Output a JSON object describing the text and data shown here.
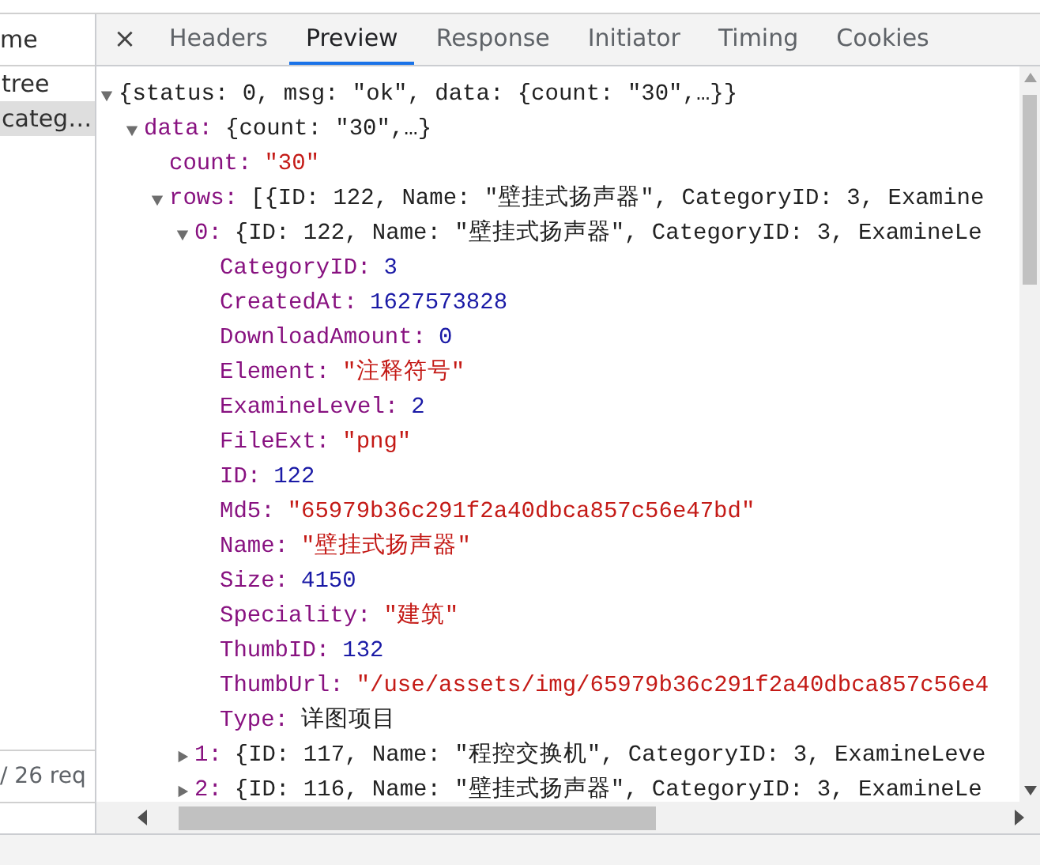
{
  "requests": {
    "header": "me",
    "items": [
      {
        "name": "tree",
        "selected": false
      },
      {
        "name": "categ…",
        "selected": true
      }
    ],
    "status": "/ 26 req"
  },
  "detail_tabs": {
    "close": "×",
    "tabs": [
      {
        "label": "Headers",
        "selected": false
      },
      {
        "label": "Preview",
        "selected": true
      },
      {
        "label": "Response",
        "selected": false
      },
      {
        "label": "Initiator",
        "selected": false
      },
      {
        "label": "Timing",
        "selected": false
      },
      {
        "label": "Cookies",
        "selected": false
      }
    ]
  },
  "preview": {
    "tree": [
      {
        "summary": "{status: 0, msg: \"ok\", data: {count: \"30\",…}}",
        "expanded": true,
        "children": [
          {
            "key": "data:",
            "summary": "{count: \"30\",…}",
            "expanded": true,
            "children": [
              {
                "key": "count:",
                "value": "\"30\"",
                "kind": "string"
              },
              {
                "key": "rows:",
                "summary": "[{ID: 122, Name: \"壁挂式扬声器\", CategoryID: 3, Examine",
                "expanded": true,
                "children": [
                  {
                    "key": "0:",
                    "summary": "{ID: 122, Name: \"壁挂式扬声器\", CategoryID: 3, ExamineLe",
                    "expanded": true,
                    "children": [
                      {
                        "key": "CategoryID:",
                        "value": "3",
                        "kind": "number"
                      },
                      {
                        "key": "CreatedAt:",
                        "value": "1627573828",
                        "kind": "number"
                      },
                      {
                        "key": "DownloadAmount:",
                        "value": "0",
                        "kind": "number"
                      },
                      {
                        "key": "Element:",
                        "value": "\"注释符号\"",
                        "kind": "string"
                      },
                      {
                        "key": "ExamineLevel:",
                        "value": "2",
                        "kind": "number"
                      },
                      {
                        "key": "FileExt:",
                        "value": "\"png\"",
                        "kind": "string"
                      },
                      {
                        "key": "ID:",
                        "value": "122",
                        "kind": "number"
                      },
                      {
                        "key": "Md5:",
                        "value": "\"65979b36c291f2a40dbca857c56e47bd\"",
                        "kind": "string"
                      },
                      {
                        "key": "Name:",
                        "value": "\"壁挂式扬声器\"",
                        "kind": "string"
                      },
                      {
                        "key": "Size:",
                        "value": "4150",
                        "kind": "number"
                      },
                      {
                        "key": "Speciality:",
                        "value": "\"建筑\"",
                        "kind": "string"
                      },
                      {
                        "key": "ThumbID:",
                        "value": "132",
                        "kind": "number"
                      },
                      {
                        "key": "ThumbUrl:",
                        "value": "\"/use/assets/img/65979b36c291f2a40dbca857c56e4",
                        "kind": "string"
                      },
                      {
                        "key": "Type:",
                        "value": "详图项目",
                        "kind": "plain"
                      }
                    ]
                  },
                  {
                    "key": "1:",
                    "summary": "{ID: 117, Name: \"程控交换机\", CategoryID: 3, ExamineLeve",
                    "expanded": false
                  },
                  {
                    "key": "2:",
                    "summary": "{ID: 116, Name: \"壁挂式扬声器\", CategoryID: 3, ExamineLe",
                    "expanded": false
                  }
                ]
              }
            ]
          }
        ]
      }
    ]
  }
}
